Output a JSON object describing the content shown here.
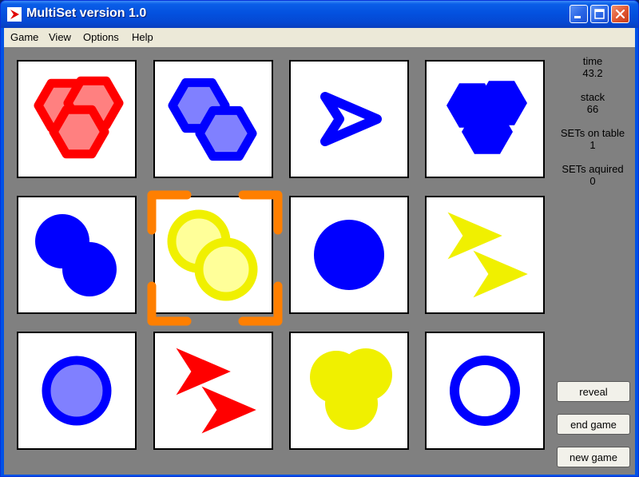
{
  "window": {
    "title": "MultiSet version 1.0"
  },
  "menu": [
    "Game",
    "View",
    "Options",
    "Help"
  ],
  "stats": [
    {
      "label": "time",
      "value": "43.2"
    },
    {
      "label": "stack",
      "value": "66"
    },
    {
      "label": "SETs on table",
      "value": "1"
    },
    {
      "label": "SETs aquired",
      "value": "0"
    }
  ],
  "buttons": {
    "reveal": "reveal",
    "end_game": "end game",
    "new_game": "new game"
  },
  "colors": {
    "red": "#ff0000",
    "blue": "#0000ff",
    "yellow": "#f0f000",
    "selection": "#ff7f00",
    "table": "#808080"
  },
  "cards": [
    {
      "count": 3,
      "shape": "hexagon",
      "color": "red",
      "fill": "shaded"
    },
    {
      "count": 2,
      "shape": "hexagon",
      "color": "blue",
      "fill": "shaded"
    },
    {
      "count": 1,
      "shape": "arrow",
      "color": "blue",
      "fill": "open"
    },
    {
      "count": 3,
      "shape": "hexagon",
      "color": "blue",
      "fill": "solid"
    },
    {
      "count": 2,
      "shape": "circle",
      "color": "blue",
      "fill": "solid"
    },
    {
      "count": 2,
      "shape": "circle",
      "color": "yellow",
      "fill": "shaded",
      "selected": true
    },
    {
      "count": 1,
      "shape": "circle",
      "color": "blue",
      "fill": "solid"
    },
    {
      "count": 2,
      "shape": "arrow",
      "color": "yellow",
      "fill": "solid"
    },
    {
      "count": 1,
      "shape": "circle",
      "color": "blue",
      "fill": "shaded"
    },
    {
      "count": 2,
      "shape": "arrow",
      "color": "red",
      "fill": "solid"
    },
    {
      "count": 3,
      "shape": "circle",
      "color": "yellow",
      "fill": "solid"
    },
    {
      "count": 1,
      "shape": "circle",
      "color": "blue",
      "fill": "open"
    }
  ]
}
